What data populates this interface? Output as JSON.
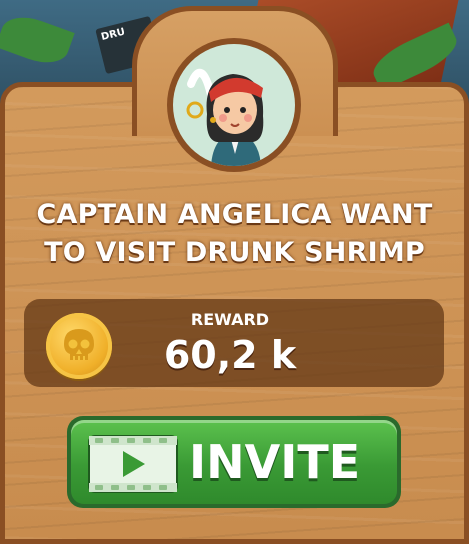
{
  "dialog": {
    "title_line1": "CAPTAIN ANGELICA WANT",
    "title_line2": "TO VISIT DRUNK SHRIMP",
    "avatar_icon": "pirate-girl-portrait",
    "reward": {
      "label": "REWARD",
      "value": "60,2 k",
      "icon": "skull-coin-icon"
    },
    "invite_button": {
      "label": "INVITE",
      "icon": "video-play-icon",
      "color": "#3a9a35"
    }
  },
  "background": {
    "sign_text": "DRU"
  },
  "colors": {
    "wood": "#c88c4e",
    "wood_border": "#8a4f23",
    "reward_box": "#5f3414",
    "coin": "#f0b02a"
  }
}
